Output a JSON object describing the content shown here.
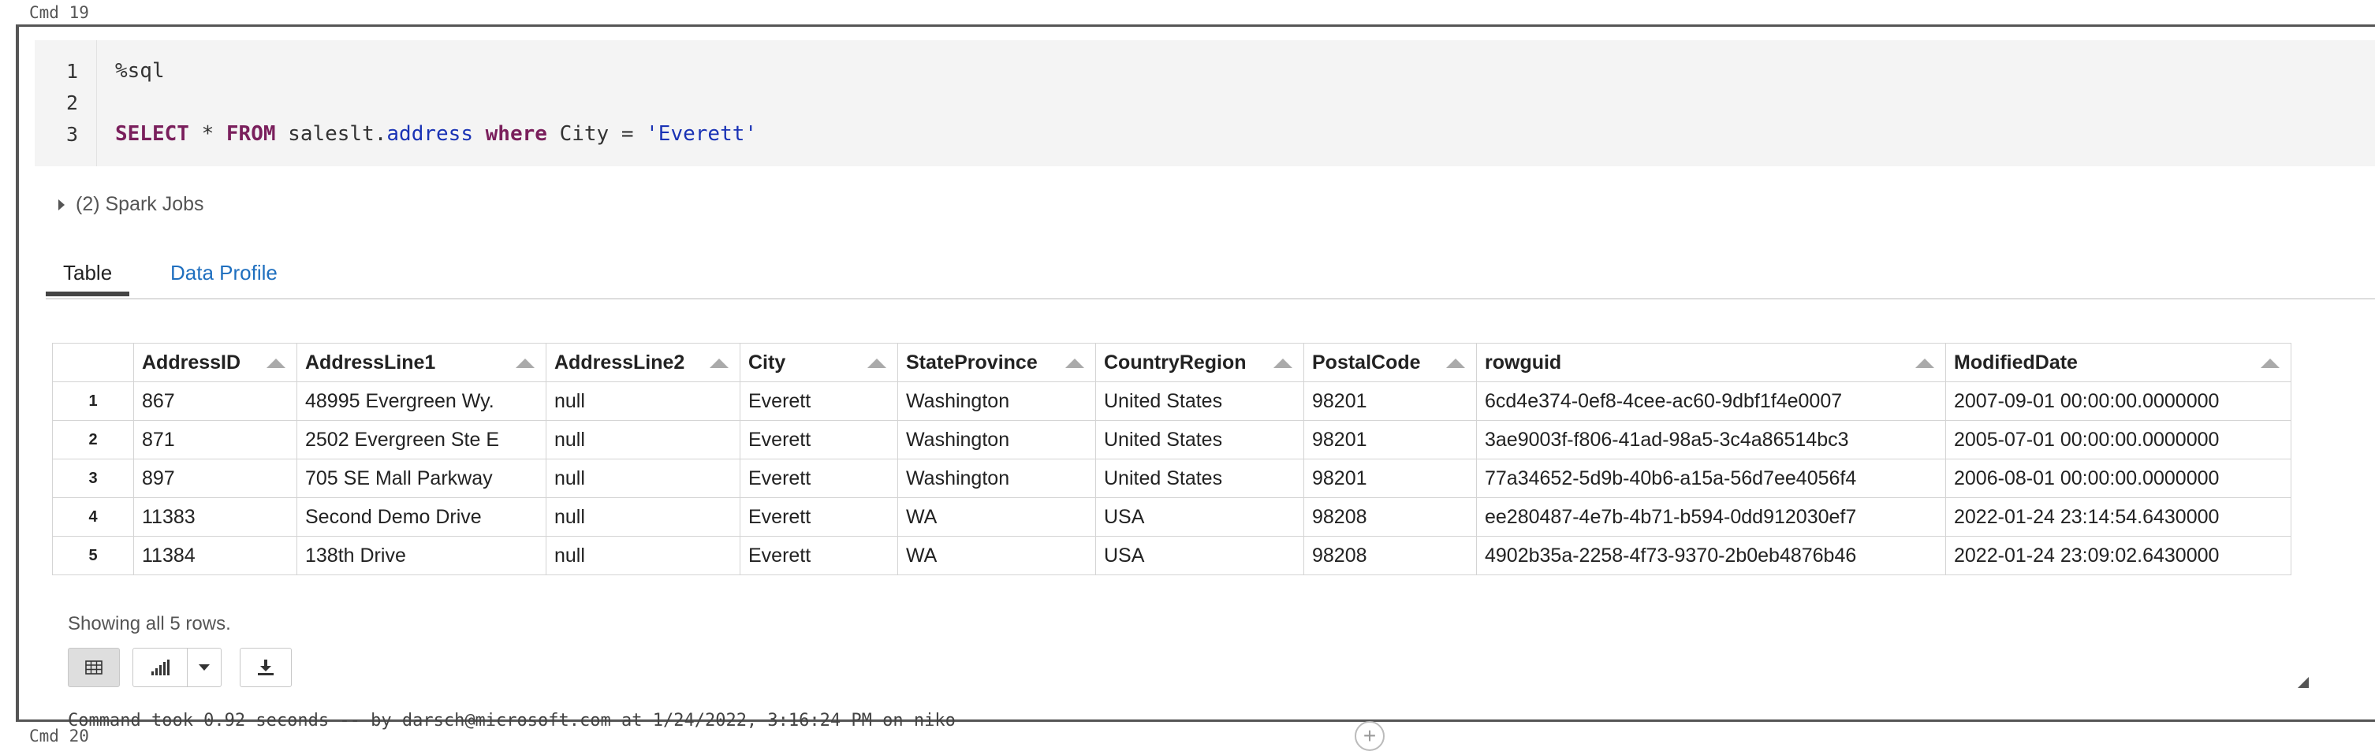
{
  "cmd_top": "Cmd 19",
  "cmd_bottom": "Cmd 20",
  "editor": {
    "line_numbers": [
      "1",
      "2",
      "3"
    ],
    "line1": "%sql",
    "line3": {
      "kw_select": "SELECT",
      "star": " * ",
      "kw_from": "FROM",
      "schema": " saleslt.",
      "table": "address",
      "kw_where": "where",
      "condition": " City = ",
      "literal": "'Everett'"
    }
  },
  "spark_jobs": "(2) Spark Jobs",
  "tabs": {
    "table": "Table",
    "data_profile": "Data Profile"
  },
  "table": {
    "columns": [
      "AddressID",
      "AddressLine1",
      "AddressLine2",
      "City",
      "StateProvince",
      "CountryRegion",
      "PostalCode",
      "rowguid",
      "ModifiedDate"
    ],
    "rows": [
      {
        "idx": "1",
        "cells": [
          "867",
          "48995 Evergreen Wy.",
          "null",
          "Everett",
          "Washington",
          "United States",
          "98201",
          "6cd4e374-0ef8-4cee-ac60-9dbf1f4e0007",
          "2007-09-01 00:00:00.0000000"
        ]
      },
      {
        "idx": "2",
        "cells": [
          "871",
          "2502 Evergreen Ste E",
          "null",
          "Everett",
          "Washington",
          "United States",
          "98201",
          "3ae9003f-f806-41ad-98a5-3c4a86514bc3",
          "2005-07-01 00:00:00.0000000"
        ]
      },
      {
        "idx": "3",
        "cells": [
          "897",
          "705 SE Mall Parkway",
          "null",
          "Everett",
          "Washington",
          "United States",
          "98201",
          "77a34652-5d9b-40b6-a15a-56d7ee4056f4",
          "2006-08-01 00:00:00.0000000"
        ]
      },
      {
        "idx": "4",
        "cells": [
          "11383",
          "Second Demo Drive",
          "null",
          "Everett",
          "WA",
          "USA",
          "98208",
          "ee280487-4e7b-4b71-b594-0dd912030ef7",
          "2022-01-24 23:14:54.6430000"
        ]
      },
      {
        "idx": "5",
        "cells": [
          "11384",
          "138th Drive",
          "null",
          "Everett",
          "WA",
          "USA",
          "98208",
          "4902b35a-2258-4f73-9370-2b0eb4876b46",
          "2022-01-24 23:09:02.6430000"
        ]
      }
    ]
  },
  "showing": "Showing all 5 rows.",
  "toolbar_icons": [
    "table-view-icon",
    "bar-chart-icon",
    "chevron-down-icon",
    "download-icon"
  ],
  "command_took": "Command took 0.92 seconds -- by darsch@microsoft.com at 1/24/2022, 3:16:24 PM on niko"
}
